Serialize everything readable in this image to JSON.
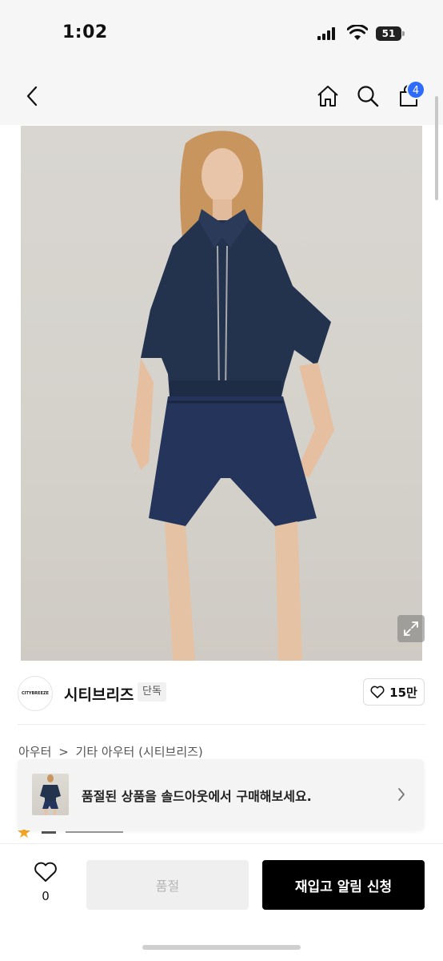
{
  "status_bar": {
    "time": "1:02",
    "battery": "51"
  },
  "nav": {
    "cart_count": "4"
  },
  "brand": {
    "logo_text": "CITYBREEZE",
    "name": "시티브리즈",
    "badge": "단독",
    "likes": "15만"
  },
  "breadcrumb": {
    "items": [
      "아우터",
      "기타 아우터 (시티브리즈)"
    ],
    "separator": ">"
  },
  "banner": {
    "text": "품절된 상품을 솔드아웃에서 구매해보세요."
  },
  "bottom": {
    "wish_count": "0",
    "soldout_label": "품절",
    "restock_label": "재입고 알림 신청"
  },
  "colors": {
    "accent": "#2d6bff",
    "primary_button": "#000000",
    "disabled_button": "#efefef"
  }
}
